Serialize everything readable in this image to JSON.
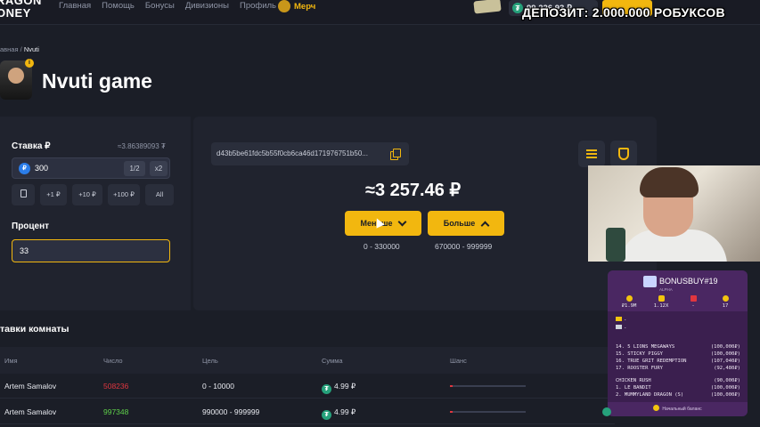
{
  "nav": {
    "logo_line1": "RAGON",
    "logo_line2": "ONEY",
    "links": [
      "Главная",
      "Помощь",
      "Бонусы",
      "Дивизионы",
      "Профиль"
    ],
    "merch": "Мерч",
    "balance": "99 226.93 ₽",
    "deposit_banner": "ДЕПОЗИТ: 2.000.000 РОБУКСОВ"
  },
  "breadcrumb": {
    "parent": "авная",
    "separator": "/",
    "current": "Nvuti"
  },
  "page_title": "Nvuti game",
  "bet_panel": {
    "bet_label": "Ставка ₽",
    "bet_hint": "≈3.86389093 ₮",
    "bet_value": "300",
    "half_label": "1/2",
    "double_label": "x2",
    "quick": [
      "+1 ₽",
      "+10 ₽",
      "+100 ₽",
      "All"
    ],
    "percent_label": "Процент",
    "percent_value": "33"
  },
  "game": {
    "hash": "d43b5be61fdc5b55f0cb6ca46d171976751b50...",
    "win_amount": "≈3 257.46 ₽",
    "less_label": "Меньше",
    "more_label": "Больше",
    "less_range": "0 - 330000",
    "more_range": "670000 - 999999"
  },
  "bets": {
    "title": "тавки комнаты",
    "headers": [
      "Имя",
      "Число",
      "Цель",
      "Сумма",
      "Шанс"
    ],
    "rows": [
      {
        "name": "Artem Samalov",
        "number": "508236",
        "number_color": "#e0363f",
        "target": "0 - 10000",
        "amount": "4.99 ₽",
        "chance": 0.03
      },
      {
        "name": "Artem Samalov",
        "number": "997348",
        "number_color": "#5fd04a",
        "target": "990000 - 999999",
        "amount": "4.99 ₽",
        "chance": 0.03
      }
    ]
  },
  "bonus_overlay": {
    "title": "BONUSBUY#19",
    "subtitle": "ALPHA",
    "stats": [
      "₽1.9M",
      "1.12X",
      "-",
      "17"
    ],
    "crown_lines": [
      "-",
      "-"
    ],
    "games": [
      {
        "name": "14. 5 LIONS MEGAWAYS",
        "value": "(100,000₽)"
      },
      {
        "name": "15. STICKY PIGGY",
        "value": "(100,000₽)"
      },
      {
        "name": "16. TRUE GRIT REDEMPTION",
        "value": "(107,040₽)"
      },
      {
        "name": "17. ROOSTER FURY",
        "value": "(92,480₽)"
      }
    ],
    "upcoming": [
      {
        "name": "CHICKEN RUSH",
        "value": "(90,000₽)"
      },
      {
        "name": "1. LE BANDIT",
        "value": "(100,000₽)"
      },
      {
        "name": "2. MUMMYLAND DRAGON (S)",
        "value": "(100,000₽)"
      }
    ],
    "footer": "Начальный баланс"
  }
}
